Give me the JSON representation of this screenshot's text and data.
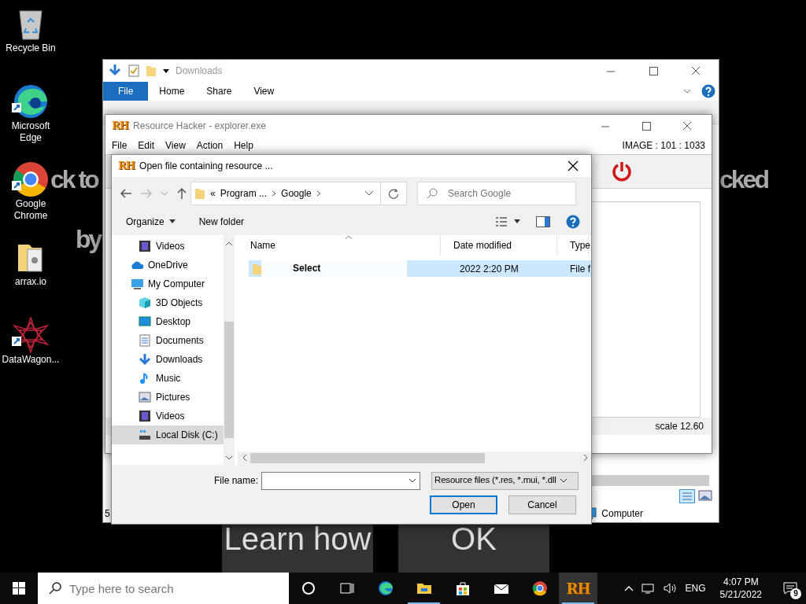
{
  "desktop_icons": [
    {
      "label": "Recycle Bin",
      "kind": "recycle",
      "shortcut": false
    },
    {
      "label": "Microsoft Edge",
      "kind": "edge",
      "shortcut": true
    },
    {
      "label": "Google Chrome",
      "kind": "chrome",
      "shortcut": true
    },
    {
      "label": "arrax.io",
      "kind": "folder",
      "shortcut": false
    },
    {
      "label": "DataWagon...",
      "kind": "star",
      "shortcut": true
    }
  ],
  "background_message": {
    "text_fragments": [
      "ck to",
      "by",
      "cked"
    ],
    "buttons": [
      "Learn how",
      "OK"
    ]
  },
  "explorer_window": {
    "title": "Downloads",
    "ribbon_tabs": [
      {
        "label": "File",
        "selected": true
      },
      {
        "label": "Home",
        "selected": false
      },
      {
        "label": "Share",
        "selected": false
      },
      {
        "label": "View",
        "selected": false
      }
    ],
    "status_count": "5",
    "status_location": "Computer"
  },
  "resource_hacker": {
    "logo": "RH",
    "title": "Resource Hacker - explorer.exe",
    "menu": [
      "File",
      "Edit",
      "View",
      "Action",
      "Help"
    ],
    "image_info": "IMAGE : 101 : 1033",
    "scale": "scale 12.60"
  },
  "dialog": {
    "logo": "RH",
    "title": "Open file containing resource ...",
    "breadcrumb_prefix": "«",
    "breadcrumb": [
      "Program ...",
      "Google"
    ],
    "search": {
      "placeholder": "Search Google"
    },
    "toolbar": [
      "Organize",
      "New folder"
    ],
    "nav_items": [
      {
        "label": "Videos",
        "kind": "video",
        "selected": false
      },
      {
        "label": "OneDrive",
        "kind": "cloud",
        "selected": false
      },
      {
        "label": "My Computer",
        "kind": "computer",
        "selected": false,
        "children": [
          {
            "label": "3D Objects",
            "kind": "cube",
            "selected": false
          },
          {
            "label": "Desktop",
            "kind": "desktop",
            "selected": false
          },
          {
            "label": "Documents",
            "kind": "doc",
            "selected": false
          },
          {
            "label": "Downloads",
            "kind": "download",
            "selected": false
          },
          {
            "label": "Music",
            "kind": "music",
            "selected": false
          },
          {
            "label": "Pictures",
            "kind": "picture",
            "selected": false
          },
          {
            "label": "Videos",
            "kind": "video",
            "selected": false
          },
          {
            "label": "Local Disk (C:)",
            "kind": "disk",
            "selected": true
          }
        ]
      }
    ],
    "columns": [
      "Name",
      "Date modified",
      "Type"
    ],
    "rows": [
      {
        "date": "2022 2:20 PM",
        "type": "File f",
        "selected": true
      }
    ],
    "tooltip": "Select",
    "file_name_label": "File name:",
    "file_type": "Resource files (*.res, *.mui, *.dll",
    "buttons": [
      "Open",
      "Cancel"
    ]
  },
  "taskbar": {
    "search": {
      "placeholder": "Type here to search"
    },
    "apps": [
      {
        "kind": "cortana",
        "running": false,
        "selected": false
      },
      {
        "kind": "taskview",
        "running": false,
        "selected": false
      },
      {
        "kind": "edge",
        "running": false,
        "selected": false
      },
      {
        "kind": "explorer",
        "running": true,
        "selected": false
      },
      {
        "kind": "store",
        "running": false,
        "selected": false
      },
      {
        "kind": "mail",
        "running": false,
        "selected": false
      },
      {
        "kind": "chrome",
        "running": false,
        "selected": false
      },
      {
        "kind": "rh",
        "label": "RH",
        "running": true,
        "selected": true
      }
    ],
    "language": "ENG",
    "time": "4:07 PM",
    "date": "5/21/2022",
    "notifications": "9"
  }
}
